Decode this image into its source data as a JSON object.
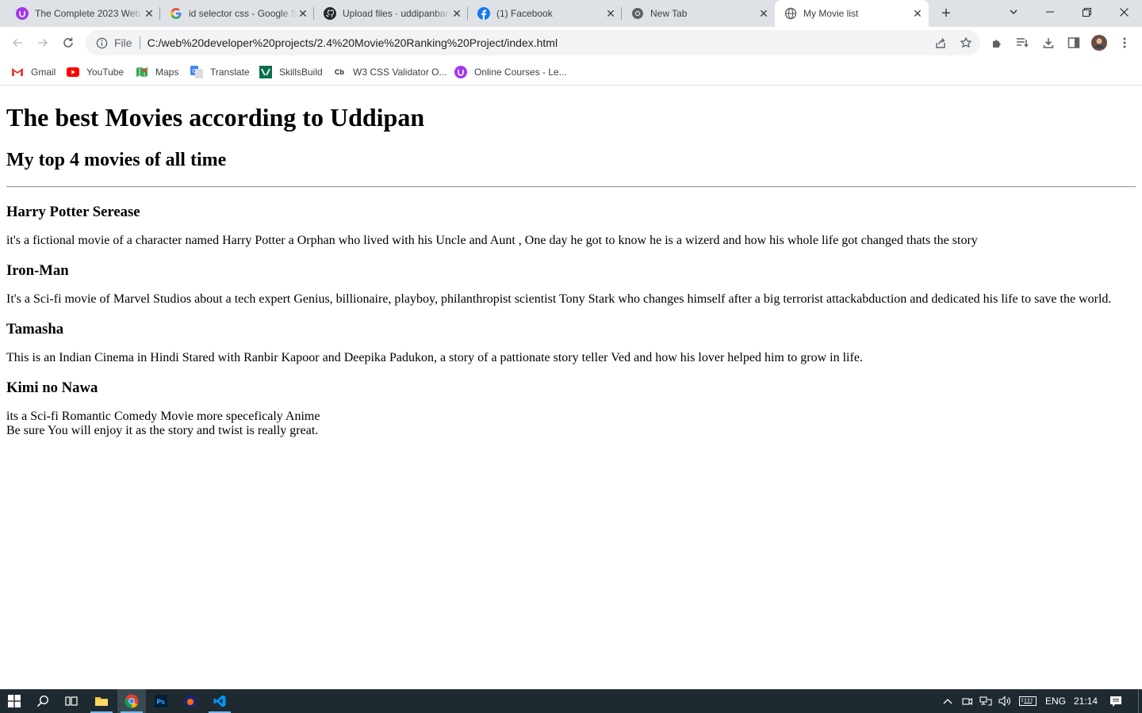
{
  "browser": {
    "tabs": [
      {
        "title": "The Complete 2023 Web Development Bootcamp",
        "favicon": "udemy-icon",
        "active": false
      },
      {
        "title": "id selector css - Google Search",
        "favicon": "google-icon",
        "active": false
      },
      {
        "title": "Upload files · uddipanbarman",
        "favicon": "github-icon",
        "active": false
      },
      {
        "title": "(1) Facebook",
        "favicon": "facebook-icon",
        "active": false
      },
      {
        "title": "New Tab",
        "favicon": "chrome-icon",
        "active": false
      },
      {
        "title": "My Movie list",
        "favicon": "globe-icon",
        "active": true
      }
    ],
    "omnibox": {
      "scheme_label": "File",
      "url": "C:/web%20developer%20projects/2.4%20Movie%20Ranking%20Project/index.html"
    },
    "bookmarks": [
      {
        "label": "Gmail",
        "icon": "gmail-icon"
      },
      {
        "label": "YouTube",
        "icon": "youtube-icon"
      },
      {
        "label": "Maps",
        "icon": "maps-icon"
      },
      {
        "label": "Translate",
        "icon": "translate-icon"
      },
      {
        "label": "SkillsBuild",
        "icon": "skillsbuild-icon"
      },
      {
        "label": "W3 CSS Validator O...",
        "icon": "cb-icon"
      },
      {
        "label": "Online Courses - Le...",
        "icon": "udemy-icon"
      }
    ]
  },
  "page": {
    "title": "The best Movies according to Uddipan",
    "subtitle": "My top 4 movies of all time",
    "movies": [
      {
        "name": "Harry Potter Serease",
        "description": "it's a fictional movie of a character named Harry Potter a Orphan who lived with his Uncle and Aunt , One day he got to know he is a wizerd and how his whole life got changed thats the story"
      },
      {
        "name": "Iron-Man",
        "description": "It's a Sci-fi movie of Marvel Studios about a tech expert Genius, billionaire, playboy, philanthropist scientist Tony Stark who changes himself after a big terrorist attackabduction and dedicated his life to save the world."
      },
      {
        "name": "Tamasha",
        "description": "This is an Indian Cinema in Hindi Stared with Ranbir Kapoor and Deepika Padukon, a story of a pattionate story teller Ved and how his lover helped him to grow in life."
      },
      {
        "name": "Kimi no Nawa",
        "description": "its a Sci-fi Romantic Comedy Movie more speceficaly Anime",
        "description_line2": "Be sure You will enjoy it as the story and twist is really great."
      }
    ]
  },
  "taskbar": {
    "language": "ENG",
    "time": "21:14"
  },
  "colors": {
    "tabstrip_bg": "#dee1e6",
    "omnibox_bg": "#f1f3f4",
    "taskbar_bg": "#1f2a30"
  }
}
